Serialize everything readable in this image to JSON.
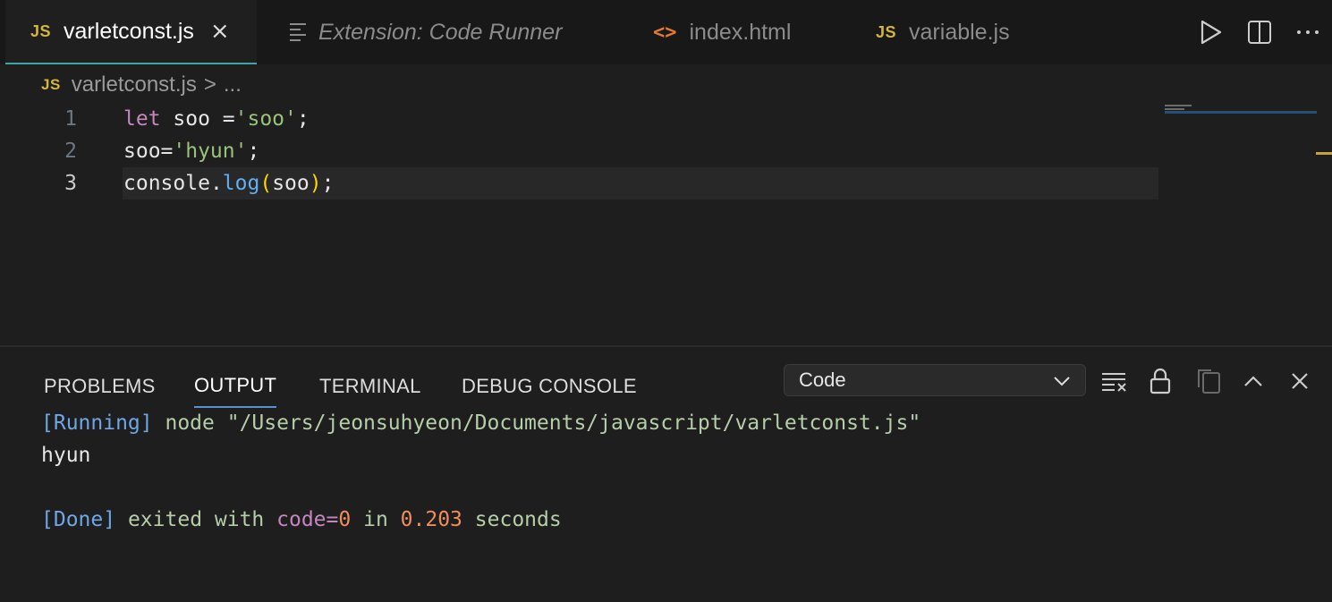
{
  "tabs": [
    {
      "icon": "JS",
      "label": "varletconst.js",
      "active": true,
      "close": "×"
    },
    {
      "icon": "preview",
      "label": "Extension: Code Runner",
      "italic": true
    },
    {
      "icon": "<>",
      "label": "index.html"
    },
    {
      "icon": "JS",
      "label": "variable.js"
    }
  ],
  "breadcrumb": {
    "icon": "JS",
    "file": "varletconst.js",
    "sep": ">",
    "more": "..."
  },
  "editor": {
    "lines": [
      {
        "num": "1",
        "tokens": [
          {
            "t": "let",
            "c": "kw"
          },
          {
            "t": " soo =",
            "c": "white"
          },
          {
            "t": "'soo'",
            "c": "str"
          },
          {
            "t": ";",
            "c": "white"
          }
        ]
      },
      {
        "num": "2",
        "tokens": [
          {
            "t": "soo=",
            "c": "white"
          },
          {
            "t": "'hyun'",
            "c": "str"
          },
          {
            "t": ";",
            "c": "white"
          }
        ]
      },
      {
        "num": "3",
        "tokens": [
          {
            "t": "console",
            "c": "white"
          },
          {
            "t": ".",
            "c": "white"
          },
          {
            "t": "log",
            "c": "fn"
          },
          {
            "t": "(",
            "c": "paren"
          },
          {
            "t": "soo",
            "c": "white"
          },
          {
            "t": ")",
            "c": "paren"
          },
          {
            "t": ";",
            "c": "white"
          }
        ]
      }
    ],
    "current_line": 3
  },
  "panel": {
    "tabs": [
      {
        "label": "PROBLEMS"
      },
      {
        "label": "OUTPUT",
        "active": true
      },
      {
        "label": "TERMINAL"
      },
      {
        "label": "DEBUG CONSOLE"
      }
    ],
    "channel": "Code"
  },
  "output": {
    "running_tag": "[Running]",
    "command": "node \"/Users/jeonsuhyeon/Documents/javascript/varletconst.js\"",
    "result": "hyun",
    "done_tag": "[Done]",
    "exited_with": "exited with",
    "code_label": "code=",
    "code_value": "0",
    "in_label": "in",
    "duration": "0.203",
    "seconds_label": "seconds"
  },
  "colors": {
    "js_badge": "#d4b53d",
    "html_badge": "#e37933",
    "active_tab_underline": "#3fa6a6",
    "panel_tab_underline": "#5a8fd1"
  }
}
